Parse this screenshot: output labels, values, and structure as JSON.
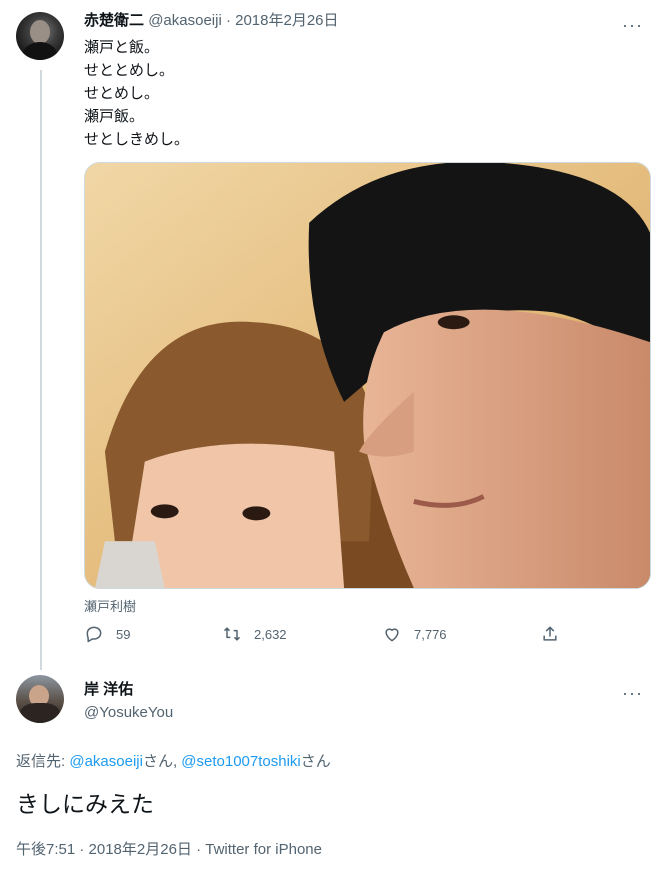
{
  "tweet1": {
    "display_name": "赤楚衛二",
    "handle": "@akasoeiji",
    "separator": " · ",
    "date": "2018年2月26日",
    "lines": [
      "瀬戸と飯。",
      "せととめし。",
      "せとめし。",
      "瀬戸飯。",
      "せとしきめし。"
    ],
    "media_caption": "瀬戸利樹",
    "actions": {
      "reply_count": "59",
      "retweet_count": "2,632",
      "like_count": "7,776"
    }
  },
  "tweet2": {
    "display_name": "岸 洋佑",
    "handle": "@YosukeYou",
    "reply_prefix": "返信先: ",
    "reply_user1": "@akasoeiji",
    "reply_suffix1": "さん, ",
    "reply_user2": "@seto1007toshiki",
    "reply_suffix2": "さん",
    "text": "きしにみえた",
    "timestamp": "午後7:51 · 2018年2月26日 · Twitter for iPhone"
  },
  "more_glyph": "···",
  "icons": [
    "reply-icon",
    "retweet-icon",
    "like-icon",
    "share-icon",
    "more-icon"
  ],
  "colors": {
    "link": "#1d9bf0",
    "muted": "#536471",
    "text": "#0f1419",
    "thread_line": "#cfd9de"
  }
}
